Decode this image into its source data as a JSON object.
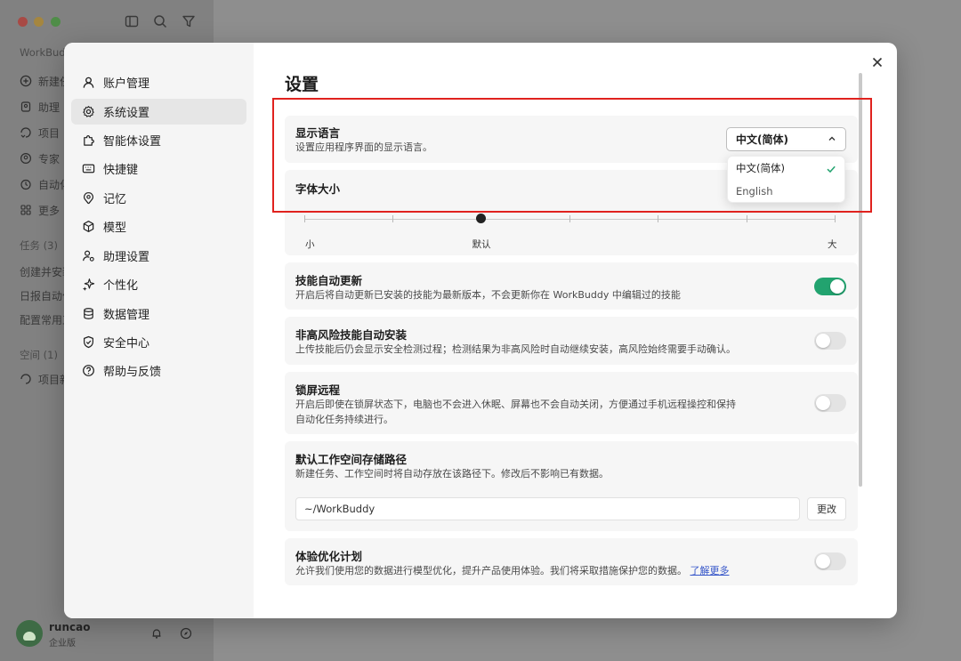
{
  "app": {
    "workspace_label": "WorkBudd",
    "sidebar_items": [
      {
        "label": "新建任",
        "icon": "plus-circle-icon"
      },
      {
        "label": "助理",
        "icon": "assistant-icon"
      },
      {
        "label": "项目",
        "icon": "project-icon"
      },
      {
        "label": "专家",
        "icon": "expert-icon"
      },
      {
        "label": "自动化",
        "icon": "automation-icon"
      },
      {
        "label": "更多",
        "icon": "grid-icon"
      }
    ],
    "tasks_header": "任务 (3)",
    "tasks": [
      "创建并安装",
      "日报自动化",
      "配置常用工"
    ],
    "spaces_header": "空间 (1)",
    "spaces": [
      "项目新"
    ],
    "user": {
      "name": "runcao",
      "plan": "企业版"
    }
  },
  "settings_nav": [
    {
      "label": "账户管理",
      "icon": "user-icon"
    },
    {
      "label": "系统设置",
      "icon": "gear-icon"
    },
    {
      "label": "智能体设置",
      "icon": "puzzle-icon"
    },
    {
      "label": "快捷键",
      "icon": "keyboard-icon"
    },
    {
      "label": "记忆",
      "icon": "memory-icon"
    },
    {
      "label": "模型",
      "icon": "cube-icon"
    },
    {
      "label": "助理设置",
      "icon": "user-gear-icon"
    },
    {
      "label": "个性化",
      "icon": "sparkle-icon"
    },
    {
      "label": "数据管理",
      "icon": "database-icon"
    },
    {
      "label": "安全中心",
      "icon": "shield-icon"
    },
    {
      "label": "帮助与反馈",
      "icon": "help-icon"
    }
  ],
  "settings_nav_active": "系统设置",
  "page_title": "设置",
  "language": {
    "title": "显示语言",
    "desc": "设置应用程序界面的显示语言。",
    "selected": "中文(简体)",
    "options": [
      "中文(简体)",
      "English"
    ]
  },
  "font_size": {
    "title": "字体大小",
    "level_labels": {
      "min": "小",
      "default": "默认",
      "max": "大"
    },
    "steps": 7,
    "value_step": 2
  },
  "skill_auto_update": {
    "title": "技能自动更新",
    "desc": "开启后将自动更新已安装的技能为最新版本，不会更新你在 WorkBuddy 中编辑过的技能",
    "enabled": true
  },
  "low_risk_auto_install": {
    "title": "非高风险技能自动安装",
    "desc": "上传技能后仍会显示安全检测过程；检测结果为非高风险时自动继续安装，高风险始终需要手动确认。",
    "enabled": false
  },
  "lock_screen_remote": {
    "title": "锁屏远程",
    "desc_line1": "开启后即使在锁屏状态下，电脑也不会进入休眠、屏幕也不会自动关闭，方便通过手机远程操控和保持",
    "desc_line2": "自动化任务持续进行。",
    "enabled": false
  },
  "workspace_path": {
    "title": "默认工作空间存储路径",
    "desc": "新建任务、工作空间时将自动存放在该路径下。修改后不影响已有数据。",
    "value": "~/WorkBuddy",
    "button": "更改"
  },
  "experience_plan": {
    "title": "体验优化计划",
    "desc": "允许我们使用您的数据进行模型优化，提升产品使用体验。我们将采取措施保护您的数据。",
    "link": "了解更多",
    "enabled": false
  },
  "colors": {
    "accent_green": "#22a36f",
    "highlight_red": "#e0221e",
    "link_blue": "#3656c9"
  }
}
